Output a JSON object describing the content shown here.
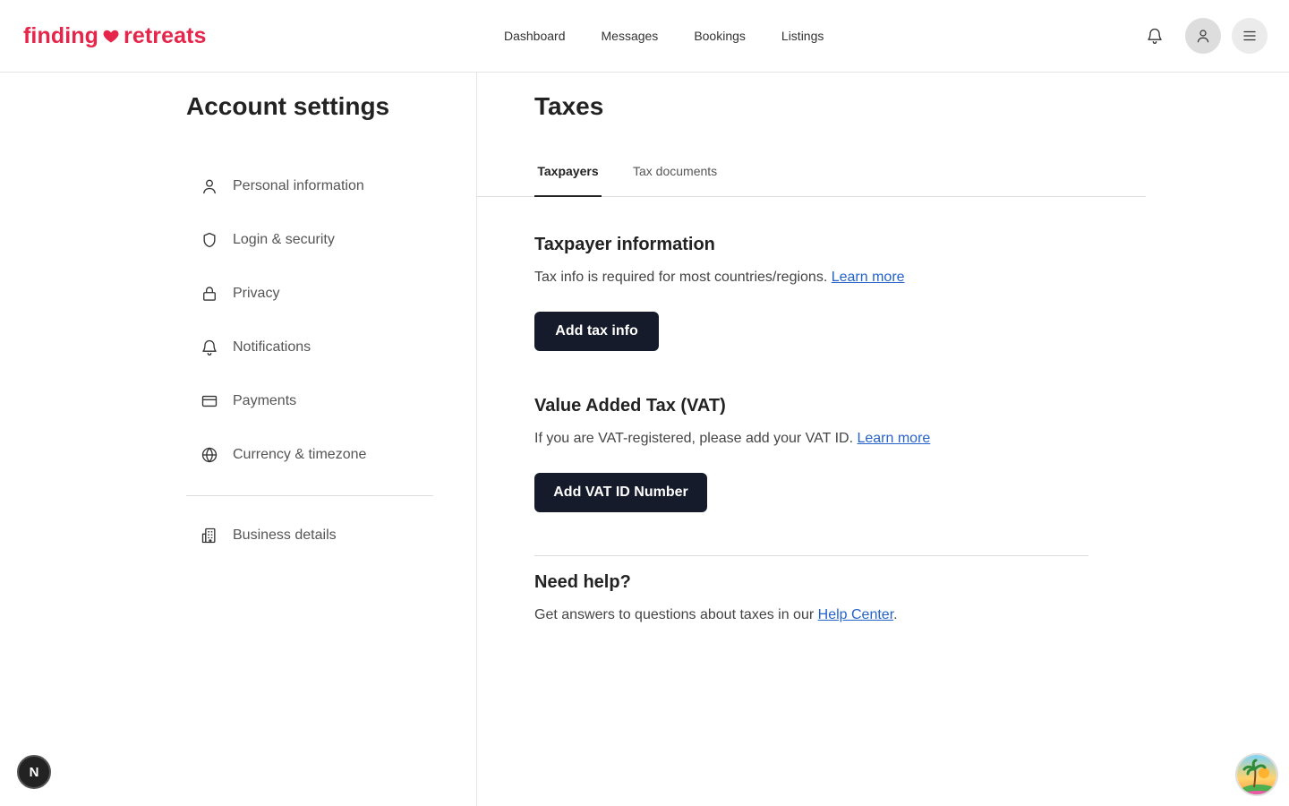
{
  "brand": {
    "part1": "finding",
    "part2": "retreats",
    "color": "#e6254a"
  },
  "nav": [
    "Dashboard",
    "Messages",
    "Bookings",
    "Listings"
  ],
  "sidebar": {
    "title": "Account settings",
    "items": [
      {
        "label": "Personal information",
        "icon": "person-icon"
      },
      {
        "label": "Login & security",
        "icon": "shield-icon"
      },
      {
        "label": "Privacy",
        "icon": "lock-icon"
      },
      {
        "label": "Notifications",
        "icon": "bell-icon"
      },
      {
        "label": "Payments",
        "icon": "credit-card-icon"
      },
      {
        "label": "Currency & timezone",
        "icon": "globe-icon"
      }
    ],
    "extra_items": [
      {
        "label": "Business details",
        "icon": "building-icon"
      }
    ]
  },
  "main": {
    "title": "Taxes",
    "tabs": [
      {
        "label": "Taxpayers",
        "active": true
      },
      {
        "label": "Tax documents",
        "active": false
      }
    ],
    "taxpayer": {
      "heading": "Taxpayer information",
      "text": "Tax info is required for most countries/regions.",
      "link": "Learn more",
      "button": "Add tax info"
    },
    "vat": {
      "heading": "Value Added Tax (VAT)",
      "text": "If you are VAT-registered, please add your VAT ID.",
      "link": "Learn more",
      "button": "Add VAT ID Number"
    },
    "help": {
      "heading": "Need help?",
      "text": "Get answers to questions about taxes in our",
      "link": "Help Center",
      "suffix": "."
    }
  },
  "floating": {
    "dev_badge": "N"
  }
}
